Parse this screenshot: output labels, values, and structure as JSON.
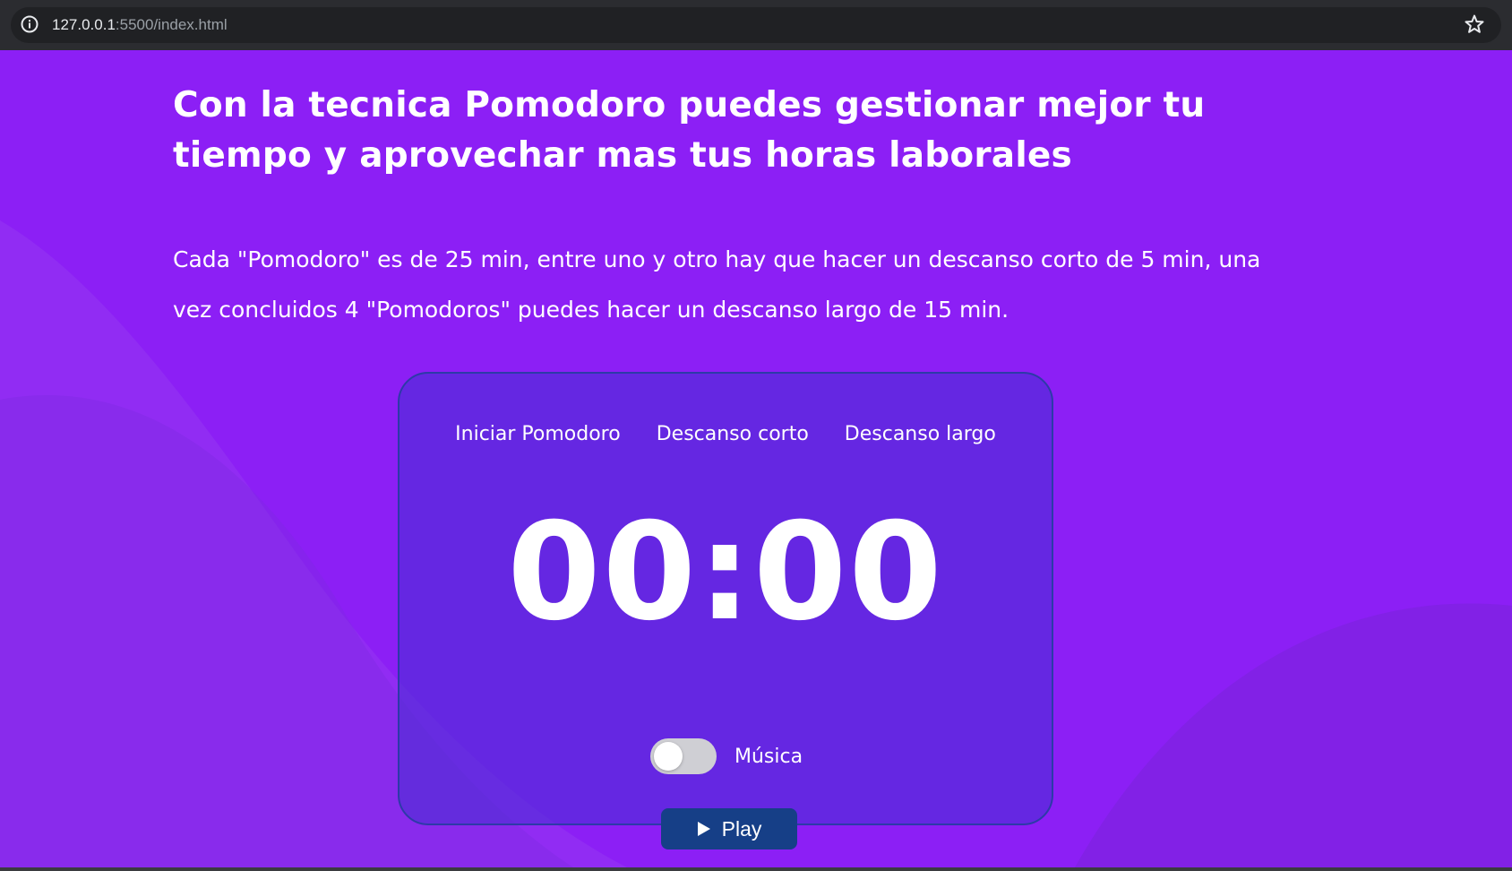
{
  "browser": {
    "url_host": "127.0.0.1",
    "url_path": ":5500/index.html",
    "info_icon": "info-icon",
    "bookmark_icon": "star-icon"
  },
  "hero": {
    "title": "Con la tecnica Pomodoro puedes gestionar mejor tu tiempo y aprovechar mas tus horas laborales",
    "description": "Cada \"Pomodoro\" es de 25 min, entre uno y otro hay que hacer un descanso corto de 5 min, una vez concluidos 4 \"Pomodoros\" puedes hacer un descanso largo de 15 min."
  },
  "timer": {
    "modes": [
      {
        "label": "Iniciar Pomodoro"
      },
      {
        "label": "Descanso corto"
      },
      {
        "label": "Descanso largo"
      }
    ],
    "display": "00:00",
    "music": {
      "label": "Música",
      "enabled": false
    },
    "play": {
      "label": "Play",
      "icon": "play-icon"
    }
  },
  "colors": {
    "background": "#8c1ff5",
    "card": "#5a2fd4",
    "card_border": "#2d3aa8",
    "play_button": "#163f87",
    "text": "#ffffff"
  }
}
